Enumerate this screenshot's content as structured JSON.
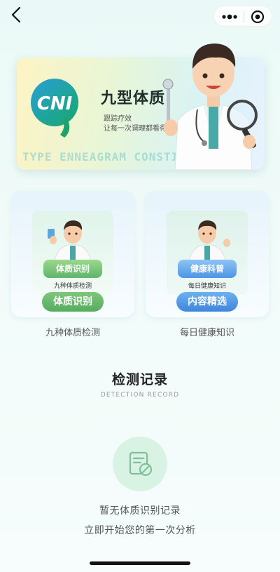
{
  "nav": {
    "back_icon": "chevron-left-icon",
    "more_icon": "more-dots-icon",
    "target_icon": "target-icon"
  },
  "banner": {
    "logo_text": "CNI",
    "logo_digit": "9",
    "title": "九型体质",
    "subtitle_1": "跟踪疗效",
    "subtitle_2": "让每一次调理都看得见",
    "english": "TYPE ENNEAGRAM CONSTITUTION"
  },
  "cards": [
    {
      "pedestal_label": "体质识别",
      "sub_caption": "九种体质检测",
      "button_label": "体质识别",
      "caption": "九种体质检测",
      "accent": "#5fb56a"
    },
    {
      "pedestal_label": "健康科普",
      "sub_caption": "每日健康知识",
      "button_label": "内容精选",
      "caption": "每日健康知识",
      "accent": "#3d86dc"
    }
  ],
  "records": {
    "title": "检测记录",
    "subtitle": "DETECTION RECORD",
    "empty_line_1": "暂无体质识别记录",
    "empty_line_2": "立即开始您的第一次分析",
    "empty_icon": "document-forbidden-icon"
  },
  "colors": {
    "background": "#eaf9f7",
    "green_accent": "#5fb56a",
    "blue_accent": "#3d86dc",
    "empty_circle": "#d8f3e4"
  }
}
